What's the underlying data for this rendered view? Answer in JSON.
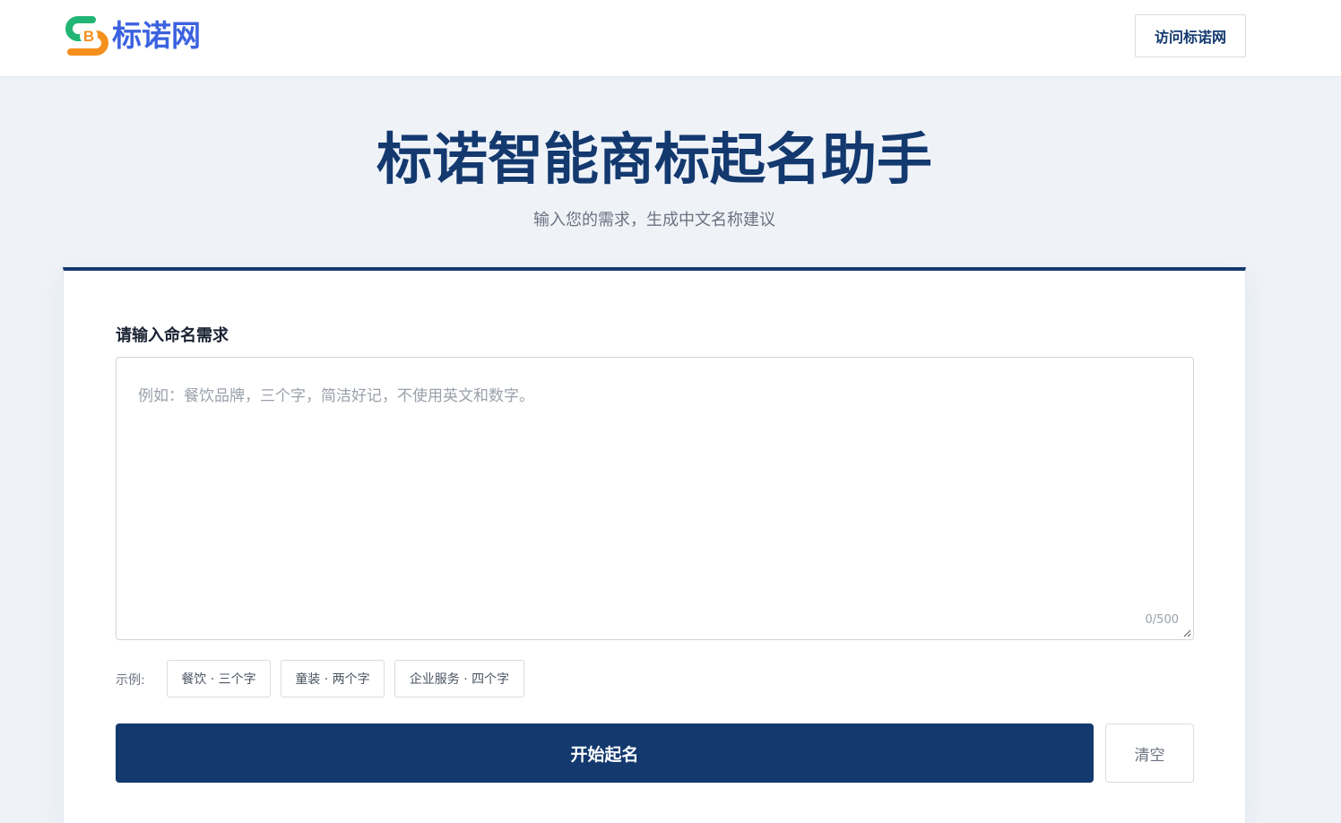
{
  "header": {
    "logo_text": "标诺网",
    "logo_letter": "B",
    "visit_button": "访问标诺网"
  },
  "hero": {
    "title": "标诺智能商标起名助手",
    "subtitle": "输入您的需求，生成中文名称建议"
  },
  "form": {
    "label": "请输入命名需求",
    "placeholder": "例如：餐饮品牌，三个字，简洁好记，不使用英文和数字。",
    "value": "",
    "counter": "0/500",
    "examples_label": "示例:",
    "examples": [
      "餐饮 · 三个字",
      "童装 · 两个字",
      "企业服务 · 四个字"
    ],
    "submit_label": "开始起名",
    "clear_label": "清空"
  },
  "colors": {
    "primary": "#13396f",
    "logo_green": "#22b573",
    "logo_orange": "#f5901e",
    "logo_blue": "#3b62e0"
  }
}
